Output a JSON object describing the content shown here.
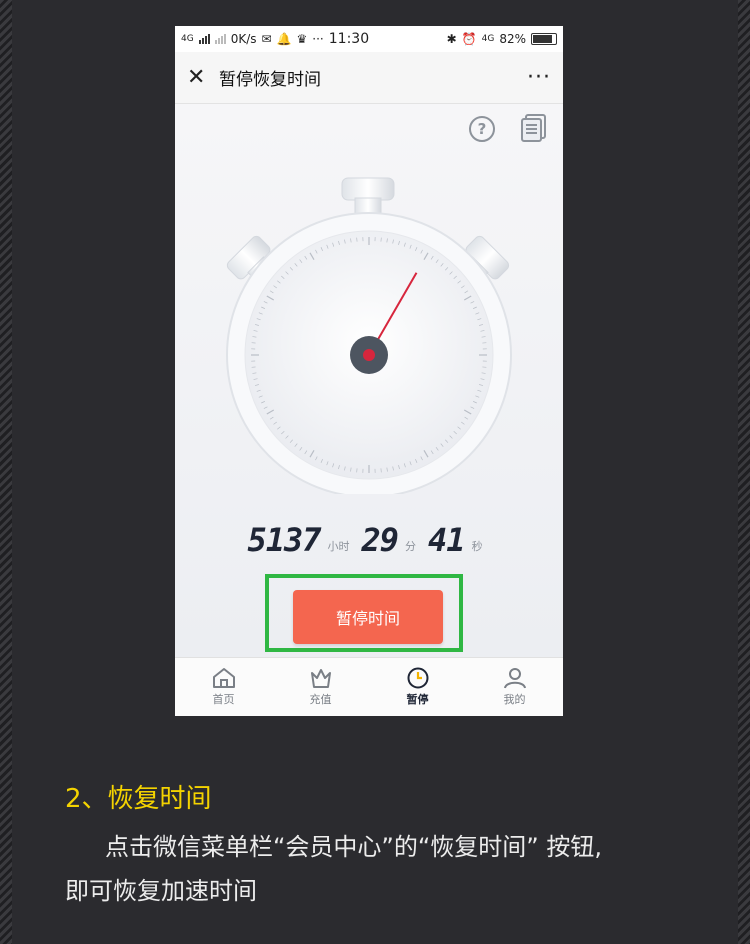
{
  "status_bar": {
    "network_left": "4G",
    "speed": "0K/s",
    "dots": "···",
    "time": "11:30",
    "network_right": "4G",
    "battery": "82%"
  },
  "title_bar": {
    "close_icon": "close-icon",
    "title": "暂停恢复时间",
    "more": "···"
  },
  "toolbar": {
    "help_icon": "question-circle-icon",
    "doc_icon": "document-icon"
  },
  "timer": {
    "hours": "5137",
    "hours_unit": "小时",
    "minutes": "29",
    "minutes_unit": "分",
    "seconds": "41",
    "seconds_unit": "秒"
  },
  "stopwatch": {
    "hand_position_seconds": 5
  },
  "action_button": {
    "label": "暂停时间",
    "highlight_color": "#2fb743",
    "color": "#f4664f"
  },
  "tabs": [
    {
      "label": "首页",
      "icon": "home-icon",
      "active": false
    },
    {
      "label": "充值",
      "icon": "crown-icon",
      "active": false
    },
    {
      "label": "暂停",
      "icon": "clock-icon",
      "active": true
    },
    {
      "label": "我的",
      "icon": "user-icon",
      "active": false
    }
  ],
  "caption": {
    "heading": "2、恢复时间",
    "line1": "点击微信菜单栏“会员中心”的“恢复时间” 按钮,",
    "line2": "即可恢复加速时间"
  }
}
